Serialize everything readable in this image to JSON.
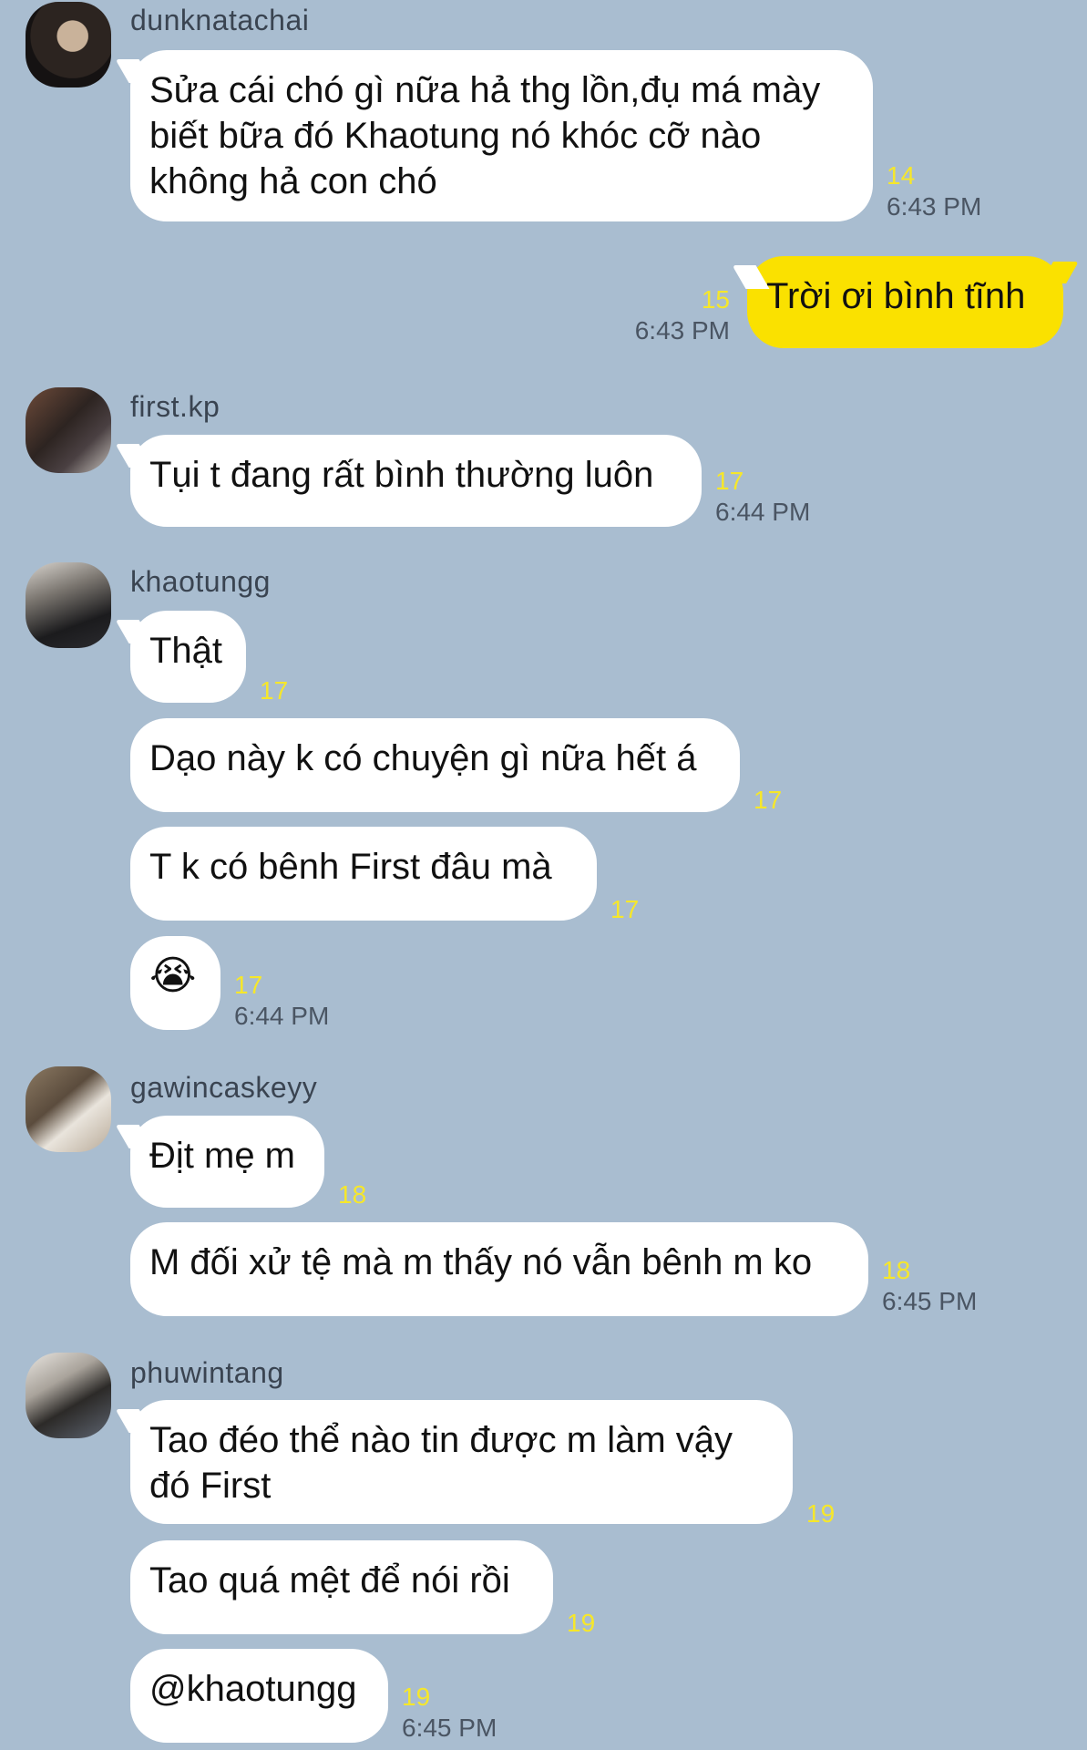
{
  "messages": [
    {
      "sender": "dunknatachai",
      "text": "Sửa cái chó gì nữa hả thg lồn,đụ má mày biết bữa đó Khaotung nó khóc cỡ nào không hả con chó",
      "count": "14",
      "time": "6:43 PM"
    },
    {
      "sender": "me",
      "text": "Trời ơi bình tĩnh",
      "count": "15",
      "time": "6:43 PM"
    },
    {
      "sender": "first.kp",
      "text": "Tụi t đang rất bình thường luôn",
      "count": "17",
      "time": "6:44 PM"
    },
    {
      "sender": "khaotungg",
      "text": "Thật",
      "count": "17"
    },
    {
      "sender": "khaotungg",
      "text": "Dạo này k có chuyện gì nữa hết á",
      "count": "17"
    },
    {
      "sender": "khaotungg",
      "text": "T k có bênh First đâu mà",
      "count": "17"
    },
    {
      "sender": "khaotungg",
      "text": "😭",
      "count": "17",
      "time": "6:44 PM"
    },
    {
      "sender": "gawincaskeyy",
      "text": "Địt mẹ m",
      "count": "18"
    },
    {
      "sender": "gawincaskeyy",
      "text": "M đối xử tệ mà m thấy nó vẫn bênh m ko",
      "count": "18",
      "time": "6:45 PM"
    },
    {
      "sender": "phuwintang",
      "text": "Tao đéo thể nào tin được m làm vậy đó First",
      "count": "19"
    },
    {
      "sender": "phuwintang",
      "text": "Tao quá mệt để nói rồi",
      "count": "19"
    },
    {
      "sender": "phuwintang",
      "text": "@khaotungg",
      "count": "19",
      "time": "6:45 PM"
    }
  ],
  "colors": {
    "background": "#a9bdd0",
    "own_bubble": "#fae100",
    "other_bubble": "#ffffff",
    "unread_count": "#f6e72a"
  }
}
